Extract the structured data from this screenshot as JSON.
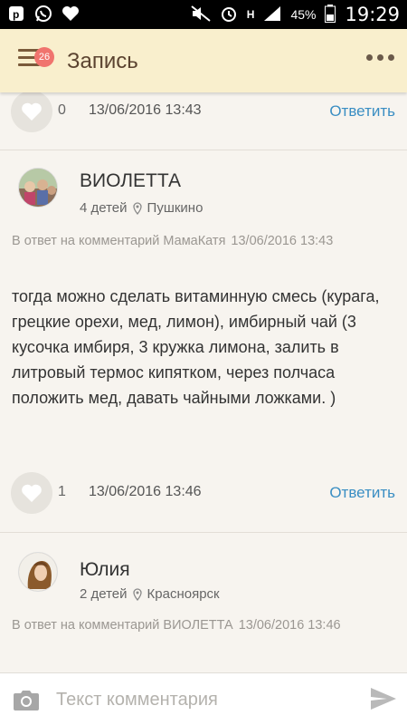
{
  "status_bar": {
    "battery": "45%",
    "time": "19:29",
    "network": "H"
  },
  "header": {
    "title": "Запись",
    "badge_count": "26"
  },
  "comments": [
    {
      "likes": "0",
      "timestamp": "13/06/2016 13:43",
      "reply_label": "Ответить"
    },
    {
      "author": "ВИОЛЕТТА",
      "children": "4 детей",
      "city": "Пушкино",
      "reply_to": "В ответ на комментарий МамаКатя",
      "reply_date": "13/06/2016 13:43",
      "text": "тогда можно сделать витаминную смесь (курага, грецкие орехи, мед, лимон), имбирный чай (3 кусочка имбиря, 3 кружка лимона, залить в литровый термос кипятком, через полчаса положить мед, давать чайными ложками. )",
      "likes": "1",
      "timestamp": "13/06/2016 13:46",
      "reply_label": "Ответить"
    },
    {
      "author": "Юлия",
      "children": "2 детей",
      "city": "Красноярск",
      "reply_to": "В ответ на комментарий ВИОЛЕТТА",
      "reply_date": "13/06/2016 13:46"
    }
  ],
  "input": {
    "placeholder": "Текст комментария"
  },
  "colors": {
    "header_bg": "#f9efcd",
    "accent_link": "#3a8ec3",
    "badge": "#f0746e",
    "page_bg": "#f7f4ef"
  }
}
